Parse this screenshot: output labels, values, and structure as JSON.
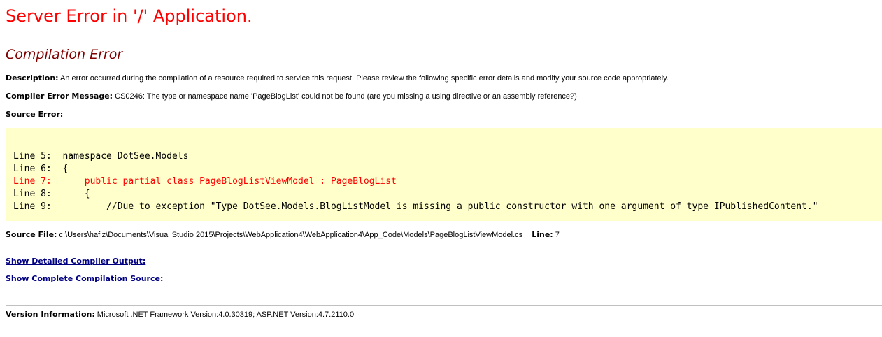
{
  "page": {
    "title": "Server Error in '/' Application.",
    "subtitle": "Compilation Error",
    "description": {
      "label": "Description:",
      "text": "An error occurred during the compilation of a resource required to service this request. Please review the following specific error details and modify your source code appropriately."
    },
    "compiler_error": {
      "label": "Compiler Error Message:",
      "text": "CS0246: The type or namespace name 'PageBlogList' could not be found (are you missing a using directive or an assembly reference?)"
    },
    "source_error": {
      "label": "Source Error:",
      "lines": [
        {
          "text": "Line 5:  namespace DotSee.Models",
          "is_error": false
        },
        {
          "text": "Line 6:  {",
          "is_error": false
        },
        {
          "text": "Line 7:      public partial class PageBlogListViewModel : PageBlogList",
          "is_error": true
        },
        {
          "text": "Line 8:      {",
          "is_error": false
        },
        {
          "text": "Line 9:          //Due to exception \"Type DotSee.Models.BlogListModel is missing a public constructor with one argument of type IPublishedContent.\"",
          "is_error": false
        }
      ]
    },
    "source_file": {
      "label": "Source File:",
      "path": "c:\\Users\\hafiz\\Documents\\Visual Studio 2015\\Projects\\WebApplication4\\WebApplication4\\App_Code\\Models\\PageBlogListViewModel.cs",
      "line_label": "Line:",
      "line_number": "7"
    },
    "links": {
      "detailed_output": "Show Detailed Compiler Output:",
      "complete_source": "Show Complete Compilation Source:"
    },
    "version": {
      "label": "Version Information:",
      "text": "Microsoft .NET Framework Version:4.0.30319; ASP.NET Version:4.7.2110.0"
    }
  },
  "colors": {
    "title": "#ff0000",
    "subtitle": "#800000",
    "code_background": "#ffffcc",
    "error_line": "#ff0000",
    "link": "#000080",
    "rule": "#c0c0c0"
  }
}
